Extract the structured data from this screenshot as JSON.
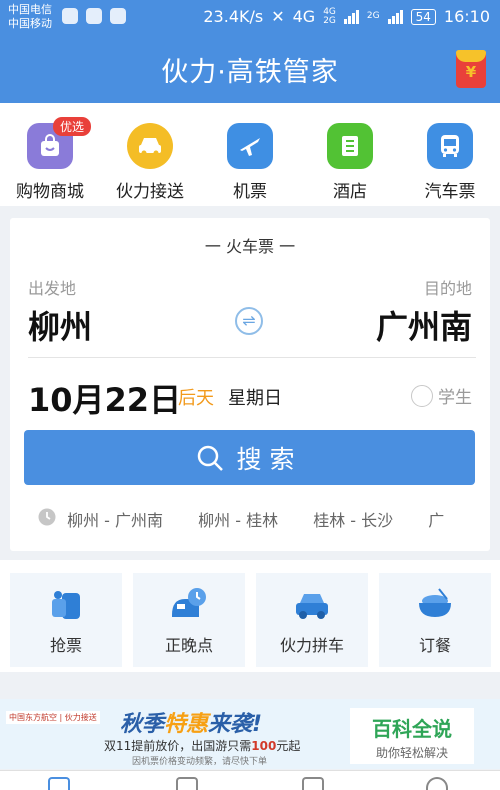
{
  "status_bar": {
    "carrier1": "中国电信",
    "carrier2": "中国移动",
    "speed": "23.4K/s",
    "network": "4G",
    "net_small_a": "4G",
    "net_small_b": "2G",
    "net_small_c": "2G",
    "battery": "54",
    "time": "16:10"
  },
  "header": {
    "title": "伙力·高铁管家",
    "redpack_icon": "red-envelope-icon",
    "redpack_symbol": "¥"
  },
  "services": [
    {
      "label": "购物商城",
      "badge": "优选",
      "icon": "shopping-bag-icon",
      "color": "#8a7bd9"
    },
    {
      "label": "伙力接送",
      "icon": "car-icon",
      "color": "#f4bd26"
    },
    {
      "label": "机票",
      "icon": "plane-icon",
      "color": "#3f8fe3"
    },
    {
      "label": "酒店",
      "icon": "hotel-icon",
      "color": "#52c234"
    },
    {
      "label": "汽车票",
      "icon": "bus-icon",
      "color": "#3f8fe3"
    }
  ],
  "ticket": {
    "title": "一 火车票 一",
    "from_label": "出发地",
    "from_city": "柳州",
    "to_label": "目的地",
    "to_city": "广州南",
    "swap_symbol": "⇌",
    "date": "10月22日",
    "relative_day": "后天",
    "weekday": "星期日",
    "student_label": "学生",
    "search_label": "搜索"
  },
  "history": [
    "柳州 - 广州南",
    "柳州 - 桂林",
    "桂林 - 长沙",
    "广"
  ],
  "features": [
    {
      "label": "抢票",
      "icon": "grab-ticket-icon"
    },
    {
      "label": "正晚点",
      "icon": "train-clock-icon"
    },
    {
      "label": "伙力拼车",
      "icon": "carpool-icon"
    },
    {
      "label": "订餐",
      "icon": "meal-bowl-icon"
    }
  ],
  "banner": {
    "logos": "中国东方航空 | 伙力接送",
    "headline_a": "秋季",
    "headline_b": "特惠",
    "headline_c": "来袭!",
    "sub_a": "双11提前放价，出国游只需",
    "sub_price": "100",
    "sub_b": "元起",
    "note": "因机票价格变动频繁，请尽快下单"
  },
  "watermark": {
    "title": "百科全说",
    "subtitle": "助你轻松解决"
  },
  "colors": {
    "primary": "#4a8fe0",
    "accent_orange": "#f29a1c",
    "badge_red": "#e9403a"
  }
}
